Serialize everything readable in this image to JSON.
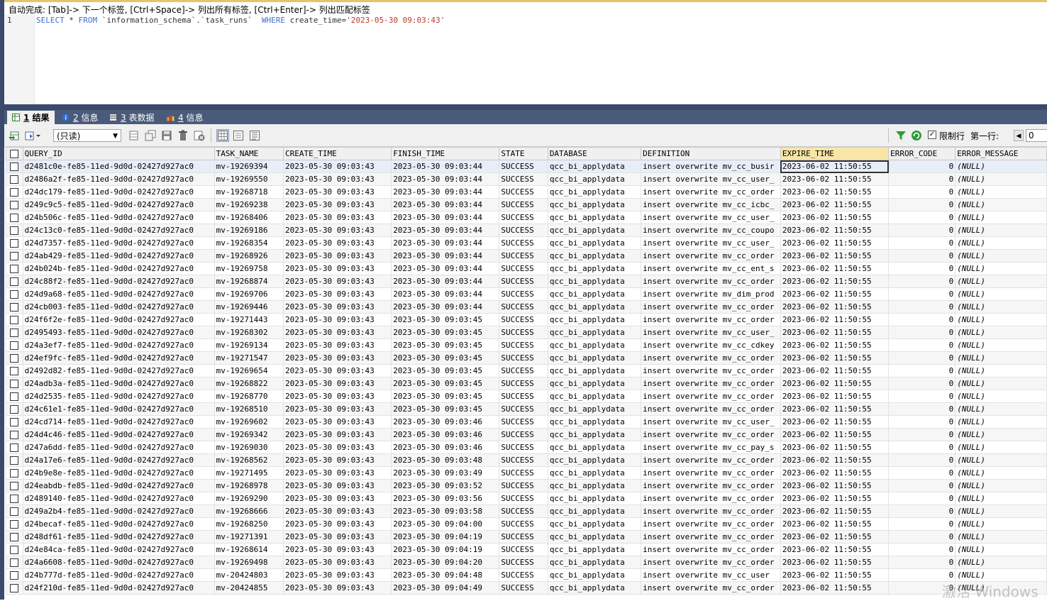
{
  "editor": {
    "hint": "自动完成: [Tab]-> 下一个标签, [Ctrl+Space]-> 列出所有标签, [Ctrl+Enter]-> 列出匹配标签",
    "line_number": "1",
    "sql": {
      "select": "SELECT",
      "star": " * ",
      "from": "FROM",
      "table": " `information_schema`.`task_runs`  ",
      "where": "WHERE",
      "cond": " create_time=",
      "value": "'2023-05-30 09:03:43'"
    }
  },
  "tabs": [
    {
      "num": "1",
      "label": "结果"
    },
    {
      "num": "2",
      "label": "信息"
    },
    {
      "num": "3",
      "label": "表数据"
    },
    {
      "num": "4",
      "label": "信息"
    }
  ],
  "toolbar": {
    "mode_select": "(只读)",
    "limit_label": "限制行",
    "first_row_label": "第一行:",
    "first_row_value": "0"
  },
  "colors": {
    "accent": "#3a4a6b",
    "tab_bar": "#4a5a7a",
    "selected_header": "#f7e6a8"
  },
  "grid": {
    "columns": [
      "QUERY_ID",
      "TASK_NAME",
      "CREATE_TIME",
      "FINISH_TIME",
      "STATE",
      "DATABASE",
      "DEFINITION",
      "EXPIRE_TIME",
      "ERROR_CODE",
      "ERROR_MESSAGE"
    ],
    "rows": [
      [
        "d2481c0e-fe85-11ed-9d0d-02427d927ac0",
        "mv-19269394",
        "2023-05-30 09:03:43",
        "2023-05-30 09:03:44",
        "SUCCESS",
        "qcc_bi_applydata",
        "insert overwrite mv_cc_busir",
        "2023-06-02 11:50:55",
        "0",
        "(NULL)"
      ],
      [
        "d2486a2f-fe85-11ed-9d0d-02427d927ac0",
        "mv-19269550",
        "2023-05-30 09:03:43",
        "2023-05-30 09:03:44",
        "SUCCESS",
        "qcc_bi_applydata",
        "insert overwrite mv_cc_user_",
        "2023-06-02 11:50:55",
        "0",
        "(NULL)"
      ],
      [
        "d24dc179-fe85-11ed-9d0d-02427d927ac0",
        "mv-19268718",
        "2023-05-30 09:03:43",
        "2023-05-30 09:03:44",
        "SUCCESS",
        "qcc_bi_applydata",
        "insert overwrite mv_cc_order",
        "2023-06-02 11:50:55",
        "0",
        "(NULL)"
      ],
      [
        "d249c9c5-fe85-11ed-9d0d-02427d927ac0",
        "mv-19269238",
        "2023-05-30 09:03:43",
        "2023-05-30 09:03:44",
        "SUCCESS",
        "qcc_bi_applydata",
        "insert overwrite mv_cc_icbc_",
        "2023-06-02 11:50:55",
        "0",
        "(NULL)"
      ],
      [
        "d24b506c-fe85-11ed-9d0d-02427d927ac0",
        "mv-19268406",
        "2023-05-30 09:03:43",
        "2023-05-30 09:03:44",
        "SUCCESS",
        "qcc_bi_applydata",
        "insert overwrite mv_cc_user_",
        "2023-06-02 11:50:55",
        "0",
        "(NULL)"
      ],
      [
        "d24c13c0-fe85-11ed-9d0d-02427d927ac0",
        "mv-19269186",
        "2023-05-30 09:03:43",
        "2023-05-30 09:03:44",
        "SUCCESS",
        "qcc_bi_applydata",
        "insert overwrite mv_cc_coupo",
        "2023-06-02 11:50:55",
        "0",
        "(NULL)"
      ],
      [
        "d24d7357-fe85-11ed-9d0d-02427d927ac0",
        "mv-19268354",
        "2023-05-30 09:03:43",
        "2023-05-30 09:03:44",
        "SUCCESS",
        "qcc_bi_applydata",
        "insert overwrite mv_cc_user_",
        "2023-06-02 11:50:55",
        "0",
        "(NULL)"
      ],
      [
        "d24ab429-fe85-11ed-9d0d-02427d927ac0",
        "mv-19268926",
        "2023-05-30 09:03:43",
        "2023-05-30 09:03:44",
        "SUCCESS",
        "qcc_bi_applydata",
        "insert overwrite mv_cc_order",
        "2023-06-02 11:50:55",
        "0",
        "(NULL)"
      ],
      [
        "d24b024b-fe85-11ed-9d0d-02427d927ac0",
        "mv-19269758",
        "2023-05-30 09:03:43",
        "2023-05-30 09:03:44",
        "SUCCESS",
        "qcc_bi_applydata",
        "insert overwrite mv_cc_ent_s",
        "2023-06-02 11:50:55",
        "0",
        "(NULL)"
      ],
      [
        "d24c88f2-fe85-11ed-9d0d-02427d927ac0",
        "mv-19268874",
        "2023-05-30 09:03:43",
        "2023-05-30 09:03:44",
        "SUCCESS",
        "qcc_bi_applydata",
        "insert overwrite mv_cc_order",
        "2023-06-02 11:50:55",
        "0",
        "(NULL)"
      ],
      [
        "d24d9a68-fe85-11ed-9d0d-02427d927ac0",
        "mv-19269706",
        "2023-05-30 09:03:43",
        "2023-05-30 09:03:44",
        "SUCCESS",
        "qcc_bi_applydata",
        "insert overwrite mv_dim_prod",
        "2023-06-02 11:50:55",
        "0",
        "(NULL)"
      ],
      [
        "d24cb003-fe85-11ed-9d0d-02427d927ac0",
        "mv-19269446",
        "2023-05-30 09:03:43",
        "2023-05-30 09:03:44",
        "SUCCESS",
        "qcc_bi_applydata",
        "insert overwrite mv_cc_order",
        "2023-06-02 11:50:55",
        "0",
        "(NULL)"
      ],
      [
        "d24f6f2e-fe85-11ed-9d0d-02427d927ac0",
        "mv-19271443",
        "2023-05-30 09:03:43",
        "2023-05-30 09:03:45",
        "SUCCESS",
        "qcc_bi_applydata",
        "insert overwrite mv_cc_order",
        "2023-06-02 11:50:55",
        "0",
        "(NULL)"
      ],
      [
        "d2495493-fe85-11ed-9d0d-02427d927ac0",
        "mv-19268302",
        "2023-05-30 09:03:43",
        "2023-05-30 09:03:45",
        "SUCCESS",
        "qcc_bi_applydata",
        "insert overwrite mv_cc_user_",
        "2023-06-02 11:50:55",
        "0",
        "(NULL)"
      ],
      [
        "d24a3ef7-fe85-11ed-9d0d-02427d927ac0",
        "mv-19269134",
        "2023-05-30 09:03:43",
        "2023-05-30 09:03:45",
        "SUCCESS",
        "qcc_bi_applydata",
        "insert overwrite mv_cc_cdkey",
        "2023-06-02 11:50:55",
        "0",
        "(NULL)"
      ],
      [
        "d24ef9fc-fe85-11ed-9d0d-02427d927ac0",
        "mv-19271547",
        "2023-05-30 09:03:43",
        "2023-05-30 09:03:45",
        "SUCCESS",
        "qcc_bi_applydata",
        "insert overwrite mv_cc_order",
        "2023-06-02 11:50:55",
        "0",
        "(NULL)"
      ],
      [
        "d2492d82-fe85-11ed-9d0d-02427d927ac0",
        "mv-19269654",
        "2023-05-30 09:03:43",
        "2023-05-30 09:03:45",
        "SUCCESS",
        "qcc_bi_applydata",
        "insert overwrite mv_cc_order",
        "2023-06-02 11:50:55",
        "0",
        "(NULL)"
      ],
      [
        "d24adb3a-fe85-11ed-9d0d-02427d927ac0",
        "mv-19268822",
        "2023-05-30 09:03:43",
        "2023-05-30 09:03:45",
        "SUCCESS",
        "qcc_bi_applydata",
        "insert overwrite mv_cc_order",
        "2023-06-02 11:50:55",
        "0",
        "(NULL)"
      ],
      [
        "d24d2535-fe85-11ed-9d0d-02427d927ac0",
        "mv-19268770",
        "2023-05-30 09:03:43",
        "2023-05-30 09:03:45",
        "SUCCESS",
        "qcc_bi_applydata",
        "insert overwrite mv_cc_order",
        "2023-06-02 11:50:55",
        "0",
        "(NULL)"
      ],
      [
        "d24c61e1-fe85-11ed-9d0d-02427d927ac0",
        "mv-19268510",
        "2023-05-30 09:03:43",
        "2023-05-30 09:03:45",
        "SUCCESS",
        "qcc_bi_applydata",
        "insert overwrite mv_cc_order",
        "2023-06-02 11:50:55",
        "0",
        "(NULL)"
      ],
      [
        "d24cd714-fe85-11ed-9d0d-02427d927ac0",
        "mv-19269602",
        "2023-05-30 09:03:43",
        "2023-05-30 09:03:46",
        "SUCCESS",
        "qcc_bi_applydata",
        "insert overwrite mv_cc_user_",
        "2023-06-02 11:50:55",
        "0",
        "(NULL)"
      ],
      [
        "d24d4c46-fe85-11ed-9d0d-02427d927ac0",
        "mv-19269342",
        "2023-05-30 09:03:43",
        "2023-05-30 09:03:46",
        "SUCCESS",
        "qcc_bi_applydata",
        "insert overwrite mv_cc_order",
        "2023-06-02 11:50:55",
        "0",
        "(NULL)"
      ],
      [
        "d247a6dd-fe85-11ed-9d0d-02427d927ac0",
        "mv-19269030",
        "2023-05-30 09:03:43",
        "2023-05-30 09:03:46",
        "SUCCESS",
        "qcc_bi_applydata",
        "insert overwrite mv_cc_pay_s",
        "2023-06-02 11:50:55",
        "0",
        "(NULL)"
      ],
      [
        "d24a17e6-fe85-11ed-9d0d-02427d927ac0",
        "mv-19268562",
        "2023-05-30 09:03:43",
        "2023-05-30 09:03:48",
        "SUCCESS",
        "qcc_bi_applydata",
        "insert overwrite mv_cc_order",
        "2023-06-02 11:50:55",
        "0",
        "(NULL)"
      ],
      [
        "d24b9e8e-fe85-11ed-9d0d-02427d927ac0",
        "mv-19271495",
        "2023-05-30 09:03:43",
        "2023-05-30 09:03:49",
        "SUCCESS",
        "qcc_bi_applydata",
        "insert overwrite mv_cc_order",
        "2023-06-02 11:50:55",
        "0",
        "(NULL)"
      ],
      [
        "d24eabdb-fe85-11ed-9d0d-02427d927ac0",
        "mv-19268978",
        "2023-05-30 09:03:43",
        "2023-05-30 09:03:52",
        "SUCCESS",
        "qcc_bi_applydata",
        "insert overwrite mv_cc_order",
        "2023-06-02 11:50:55",
        "0",
        "(NULL)"
      ],
      [
        "d2489140-fe85-11ed-9d0d-02427d927ac0",
        "mv-19269290",
        "2023-05-30 09:03:43",
        "2023-05-30 09:03:56",
        "SUCCESS",
        "qcc_bi_applydata",
        "insert overwrite mv_cc_order",
        "2023-06-02 11:50:55",
        "0",
        "(NULL)"
      ],
      [
        "d249a2b4-fe85-11ed-9d0d-02427d927ac0",
        "mv-19268666",
        "2023-05-30 09:03:43",
        "2023-05-30 09:03:58",
        "SUCCESS",
        "qcc_bi_applydata",
        "insert overwrite mv_cc_order",
        "2023-06-02 11:50:55",
        "0",
        "(NULL)"
      ],
      [
        "d24becaf-fe85-11ed-9d0d-02427d927ac0",
        "mv-19268250",
        "2023-05-30 09:03:43",
        "2023-05-30 09:04:00",
        "SUCCESS",
        "qcc_bi_applydata",
        "insert overwrite mv_cc_order",
        "2023-06-02 11:50:55",
        "0",
        "(NULL)"
      ],
      [
        "d248df61-fe85-11ed-9d0d-02427d927ac0",
        "mv-19271391",
        "2023-05-30 09:03:43",
        "2023-05-30 09:04:19",
        "SUCCESS",
        "qcc_bi_applydata",
        "insert overwrite mv_cc_order",
        "2023-06-02 11:50:55",
        "0",
        "(NULL)"
      ],
      [
        "d24e84ca-fe85-11ed-9d0d-02427d927ac0",
        "mv-19268614",
        "2023-05-30 09:03:43",
        "2023-05-30 09:04:19",
        "SUCCESS",
        "qcc_bi_applydata",
        "insert overwrite mv_cc_order",
        "2023-06-02 11:50:55",
        "0",
        "(NULL)"
      ],
      [
        "d24a6608-fe85-11ed-9d0d-02427d927ac0",
        "mv-19269498",
        "2023-05-30 09:03:43",
        "2023-05-30 09:04:20",
        "SUCCESS",
        "qcc_bi_applydata",
        "insert overwrite mv_cc_order",
        "2023-06-02 11:50:55",
        "0",
        "(NULL)"
      ],
      [
        "d24b777d-fe85-11ed-9d0d-02427d927ac0",
        "mv-20424803",
        "2023-05-30 09:03:43",
        "2023-05-30 09:04:48",
        "SUCCESS",
        "qcc_bi_applydata",
        "insert overwrite mv_cc_user",
        "2023-06-02 11:50:55",
        "0",
        "(NULL)"
      ],
      [
        "d24f210d-fe85-11ed-9d0d-02427d927ac0",
        "mv-20424855",
        "2023-05-30 09:03:43",
        "2023-05-30 09:04:49",
        "SUCCESS",
        "qcc_bi_applydata",
        "insert overwrite mv_cc_order",
        "2023-06-02 11:50:55",
        "0",
        "(NULL)"
      ]
    ]
  },
  "watermark": "激活 Windows"
}
